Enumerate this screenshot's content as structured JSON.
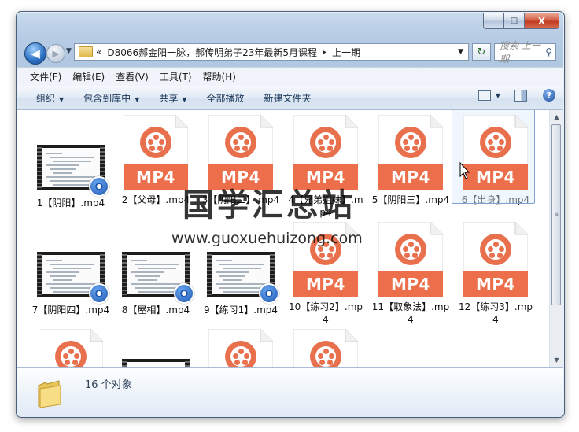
{
  "window": {
    "buttons": {
      "minimize": "─",
      "maximize": "□",
      "close": "X"
    }
  },
  "nav": {
    "back_icon": "◀",
    "forward_icon": "▶",
    "history_icon": "▼",
    "address": {
      "overflow": "«",
      "segment_1": "D8066郝金阳一脉，郝传明弟子23年最新5月课程",
      "separator": "▸",
      "segment_2": "上一期",
      "dropdown": "▼"
    },
    "refresh_icon": "↻",
    "search_placeholder": "搜索 上一期",
    "search_icon": "⚲"
  },
  "menubar": {
    "items": [
      "文件(F)",
      "编辑(E)",
      "查看(V)",
      "工具(T)",
      "帮助(H)"
    ]
  },
  "commandbar": {
    "organize": "组织",
    "include_in_library": "包含到库中",
    "share": "共享",
    "play_all": "全部播放",
    "new_folder": "新建文件夹",
    "dropdown_arrow": "▼",
    "help": "?"
  },
  "files": [
    {
      "name": "1【阴阳】.mp4",
      "kind": "thumb"
    },
    {
      "name": "2【父母】.mp4",
      "kind": "mp4"
    },
    {
      "name": "3【阴阳二】.mp4",
      "kind": "mp4"
    },
    {
      "name": "4【兄弟姐妹】.mp4",
      "kind": "mp4"
    },
    {
      "name": "5【阴阳三】.mp4",
      "kind": "mp4"
    },
    {
      "name": "6【出身】.mp4",
      "kind": "mp4"
    },
    {
      "name": "7【阴阳四】.mp4",
      "kind": "thumb"
    },
    {
      "name": "8【屋相】.mp4",
      "kind": "thumb"
    },
    {
      "name": "9【练习1】.mp4",
      "kind": "thumb"
    },
    {
      "name": "10【练习2】.mp4",
      "kind": "mp4"
    },
    {
      "name": "11【取象法】.mp4",
      "kind": "mp4"
    },
    {
      "name": "12【练习3】.mp4",
      "kind": "mp4"
    },
    {
      "name": "",
      "kind": "mp4"
    },
    {
      "name": "",
      "kind": "thumb"
    },
    {
      "name": "",
      "kind": "mp4"
    },
    {
      "name": "",
      "kind": "mp4"
    }
  ],
  "icon_text": "MP4",
  "status": {
    "count": "16 个对象"
  },
  "watermark": {
    "line1": "国学汇总站",
    "line2": "www.guoxuehuizong.com"
  },
  "colors": {
    "mp4_orange": "#ec6e4a",
    "window_frame": "#b7cce4"
  }
}
